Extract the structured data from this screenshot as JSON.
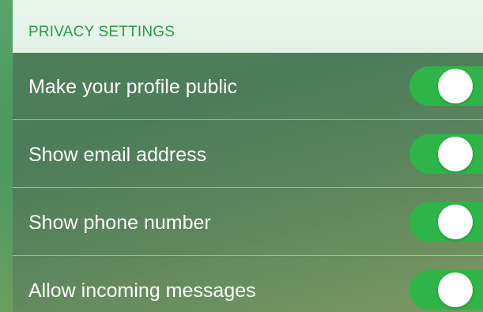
{
  "privacy": {
    "header": "PRIVACY SETTINGS",
    "items": [
      {
        "label": "Make your profile public",
        "enabled": true
      },
      {
        "label": "Show email address",
        "enabled": true
      },
      {
        "label": "Show phone number",
        "enabled": true
      },
      {
        "label": "Allow incoming messages",
        "enabled": true
      }
    ]
  },
  "colors": {
    "header_text": "#2f9b4b",
    "header_background": "#e6f4e9",
    "toggle_on": "#2eb548",
    "toggle_knob": "#ffffff",
    "row_text": "#ffffff"
  }
}
